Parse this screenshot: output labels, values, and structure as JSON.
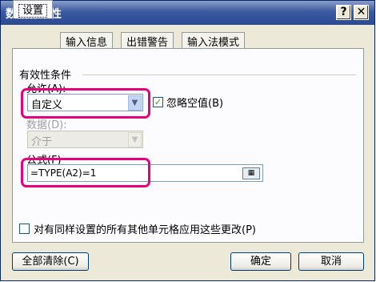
{
  "window": {
    "title": "数据有效性",
    "help_glyph": "?",
    "close_glyph": "✕"
  },
  "tabs": [
    {
      "label": "设置",
      "active": true
    },
    {
      "label": "输入信息",
      "active": false
    },
    {
      "label": "出错警告",
      "active": false
    },
    {
      "label": "输入法模式",
      "active": false
    }
  ],
  "criteria": {
    "group_label": "有效性条件",
    "allow_label": "允许(A):",
    "allow_value": "自定义",
    "ignore_blank_label": "忽略空值(B)",
    "ignore_blank_checked": true,
    "data_label": "数据(D):",
    "data_value": "介于",
    "formula_label": "公式(F)",
    "formula_value": "=TYPE(A2)=1"
  },
  "apply_all_label": "对有同样设置的所有其他单元格应用这些更改(P)",
  "apply_all_checked": false,
  "buttons": {
    "clear_all": "全部清除(C)",
    "ok": "确定",
    "cancel": "取消"
  },
  "colors": {
    "highlight": "#e6007e",
    "title_bar": "#2a4a94"
  }
}
